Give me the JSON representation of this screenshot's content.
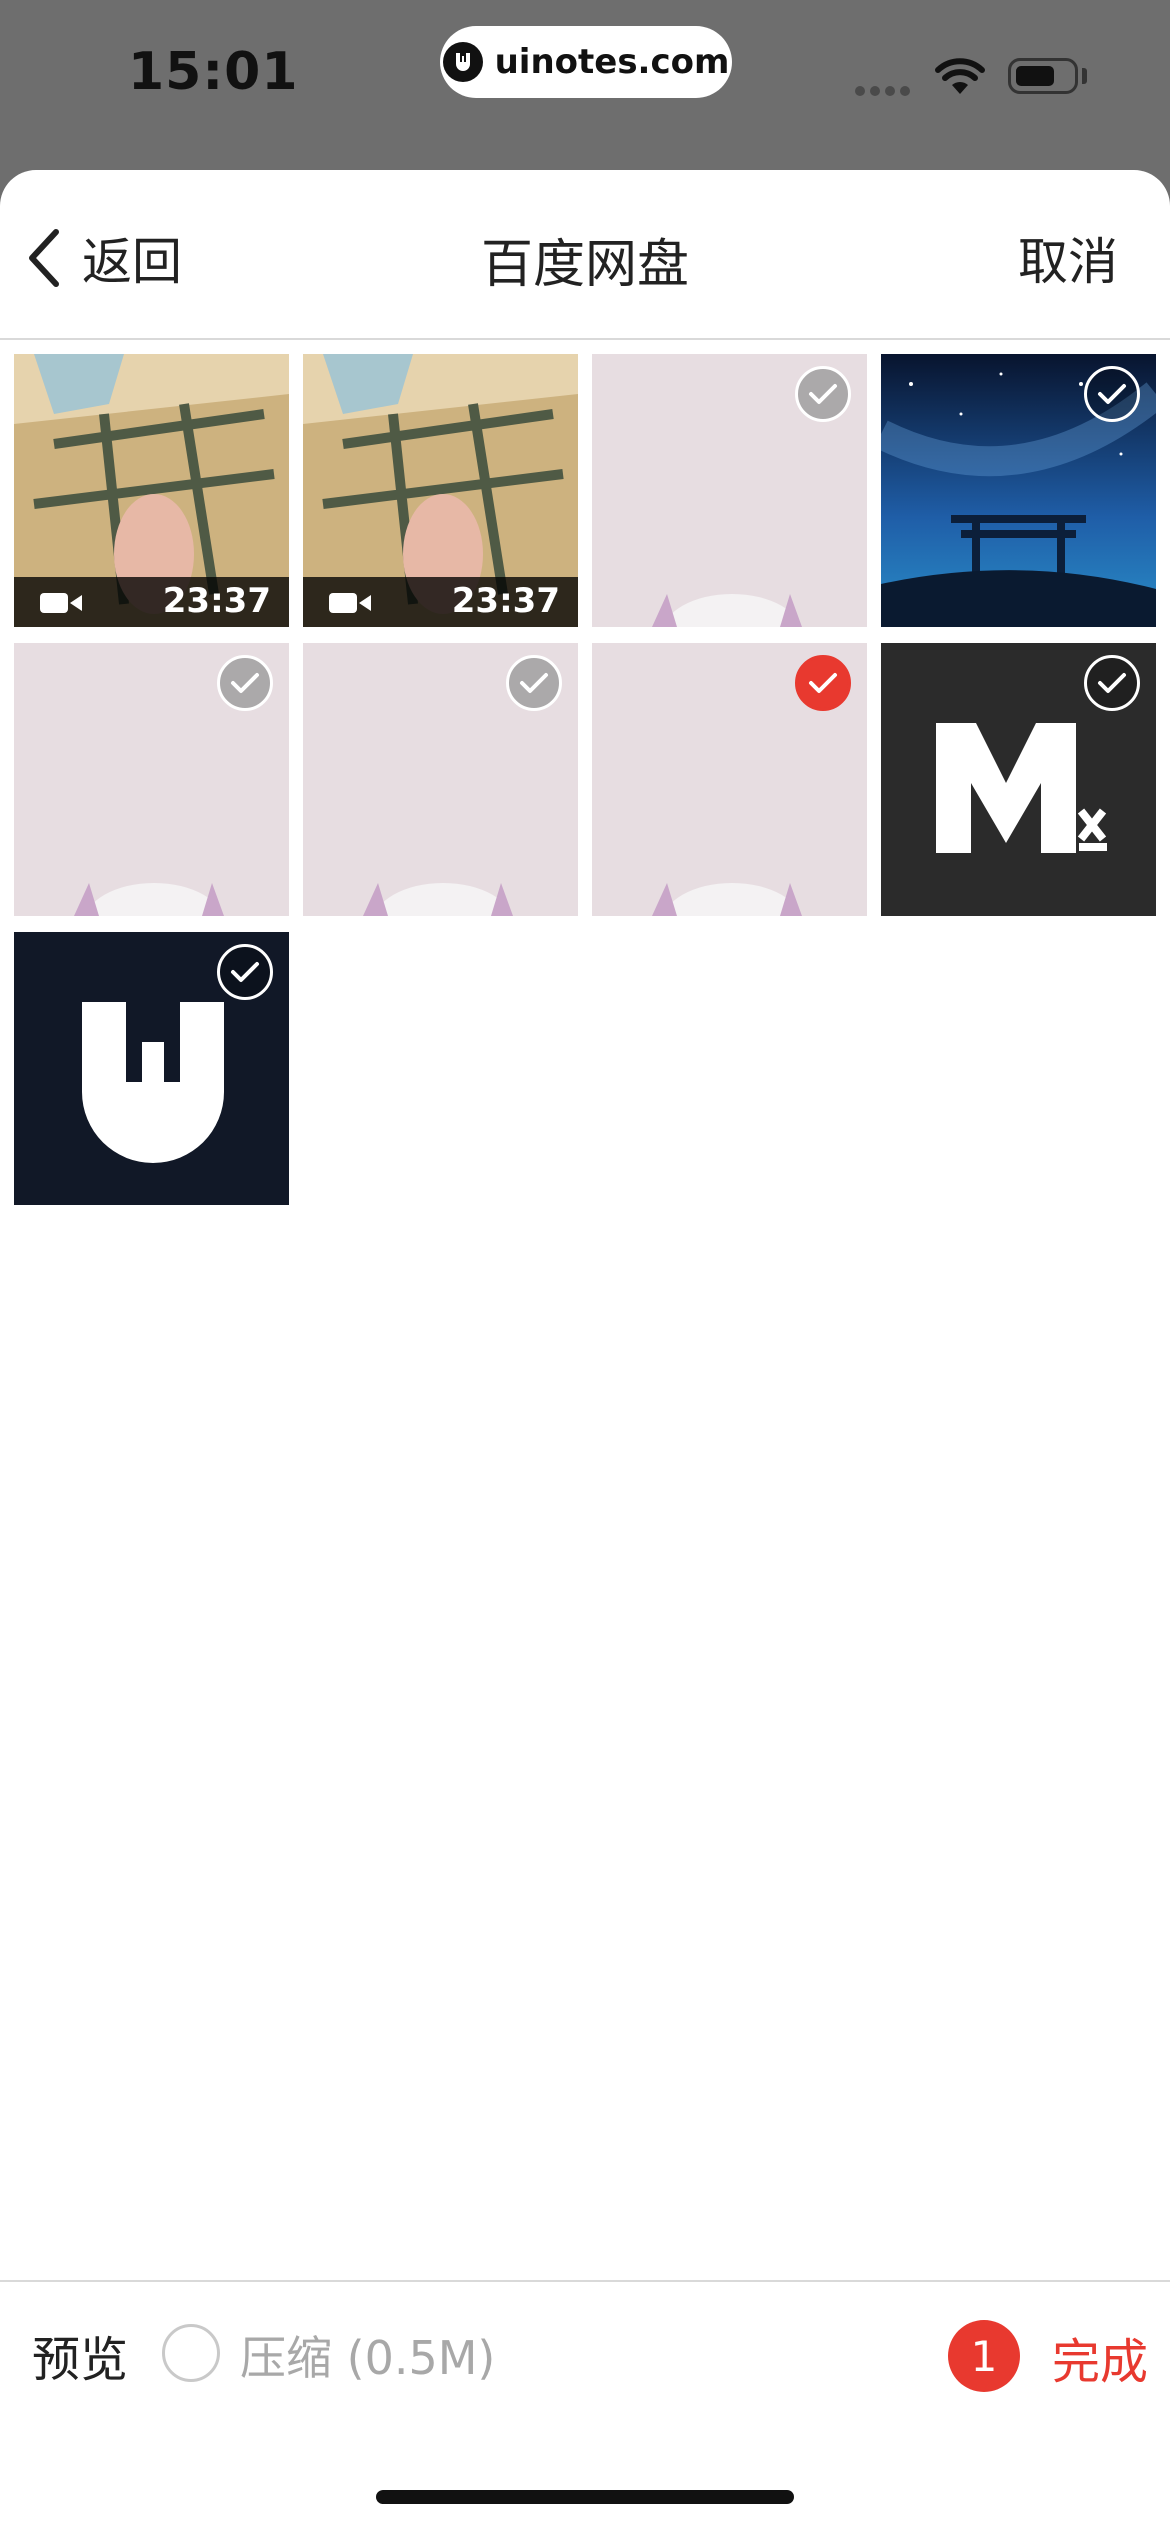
{
  "status_bar": {
    "time": "15:01",
    "url": "uinotes.com"
  },
  "nav": {
    "back_label": "返回",
    "title": "百度网盘",
    "cancel_label": "取消"
  },
  "grid": {
    "items": [
      {
        "kind": "video",
        "duration": "23:37"
      },
      {
        "kind": "video",
        "duration": "23:37"
      },
      {
        "kind": "image",
        "selected": false
      },
      {
        "kind": "image",
        "selected": false
      },
      {
        "kind": "image",
        "selected": false
      },
      {
        "kind": "image",
        "selected": false
      },
      {
        "kind": "image",
        "selected": true
      },
      {
        "kind": "image",
        "selected": false
      },
      {
        "kind": "image",
        "selected": false
      }
    ]
  },
  "bottom": {
    "preview_label": "预览",
    "compress_label": "压缩",
    "compress_size": "(0.5M)",
    "selected_count": "1",
    "done_label": "完成"
  },
  "colors": {
    "accent": "#e8392f",
    "sheet": "#ffffff",
    "backdrop": "#6e6e6e"
  }
}
